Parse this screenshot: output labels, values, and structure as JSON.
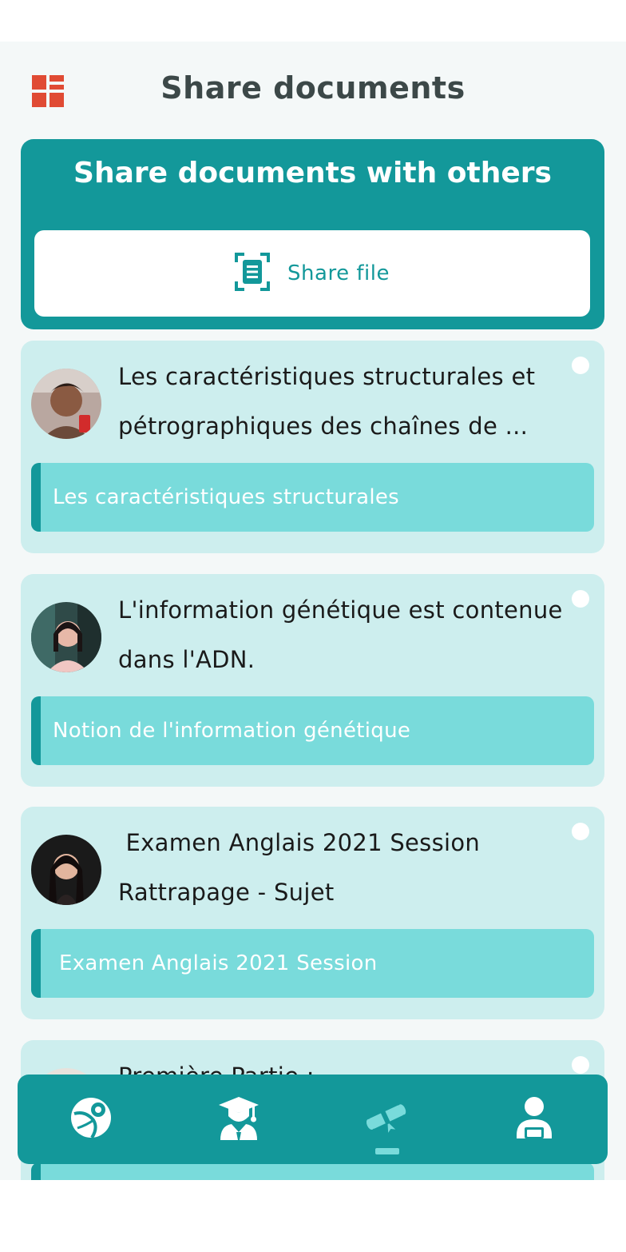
{
  "header": {
    "title": "Share documents",
    "menu_icon": "grid-menu-icon"
  },
  "share_panel": {
    "heading": "Share documents with others",
    "button_label": "Share file",
    "button_icon": "document-scan-icon"
  },
  "documents": [
    {
      "title": "Les caractéristiques structurales et pétrographiques des chaînes de ...",
      "tag": "Les caractéristiques structurales",
      "avatar": "avatar-photo"
    },
    {
      "title": "L'information génétique est contenue dans l'ADN.",
      "tag": "Notion de l'information génétique",
      "avatar": "avatar-photo"
    },
    {
      "title": " Examen Anglais 2021 Session Rattrapage - Sujet",
      "tag": "Examen Anglais 2021 Session",
      "avatar": "avatar-photo"
    },
    {
      "title": "Première Partie :",
      "tag": "",
      "avatar": "avatar-photo"
    }
  ],
  "bottom_nav": {
    "items": [
      {
        "icon": "globe-icon"
      },
      {
        "icon": "graduate-icon"
      },
      {
        "icon": "diploma-icon"
      },
      {
        "icon": "profile-icon"
      }
    ],
    "active_index": 2
  },
  "colors": {
    "primary": "#13989a",
    "accent": "#79dbdb",
    "card_bg": "#cdeeee",
    "menu_icon": "#e04b34",
    "title_text": "#3c4848"
  }
}
